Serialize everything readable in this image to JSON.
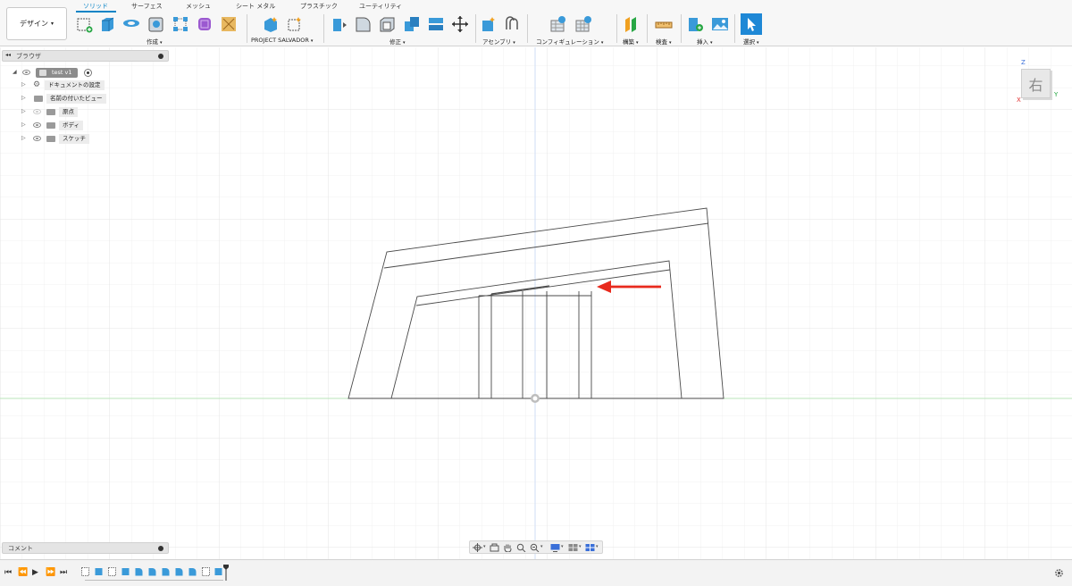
{
  "workspace": {
    "label": "デザイン",
    "icon": "chevron-down-icon"
  },
  "tabs": [
    "ソリッド",
    "サーフェス",
    "メッシュ",
    "シート メタル",
    "プラスチック",
    "ユーティリティ"
  ],
  "active_tab": "ソリッド",
  "toolbar_groups": {
    "create": "作成",
    "project": "PROJECT SALVADOR",
    "modify": "修正",
    "assemble": "アセンブリ",
    "configure": "コンフィギュレーション",
    "construct": "構築",
    "inspect": "検査",
    "insert": "挿入",
    "select": "選択"
  },
  "browser": {
    "title": "ブラウザ",
    "root": "test v1",
    "items": [
      {
        "label": "ドキュメントの設定",
        "icon": "gear-icon"
      },
      {
        "label": "名前の付いたビュー",
        "icon": "folder-icon"
      },
      {
        "label": "原点",
        "icon": "folder-icon",
        "eye": "hidden"
      },
      {
        "label": "ボディ",
        "icon": "folder-icon",
        "eye": "visible"
      },
      {
        "label": "スケッチ",
        "icon": "folder-icon",
        "eye": "visible"
      }
    ]
  },
  "viewcube": {
    "face": "右",
    "axis_z": "Z",
    "axis_x": "X",
    "axis_y": "Y"
  },
  "comments": {
    "title": "コメント"
  },
  "colors": {
    "accent": "#0a84c6",
    "annotation_arrow": "#e8291c",
    "x_axis": "#e03030",
    "y_axis": "#28a745",
    "z_axis": "#3a6fd8",
    "toolbar_icon_blue": "#3a9ad9"
  }
}
